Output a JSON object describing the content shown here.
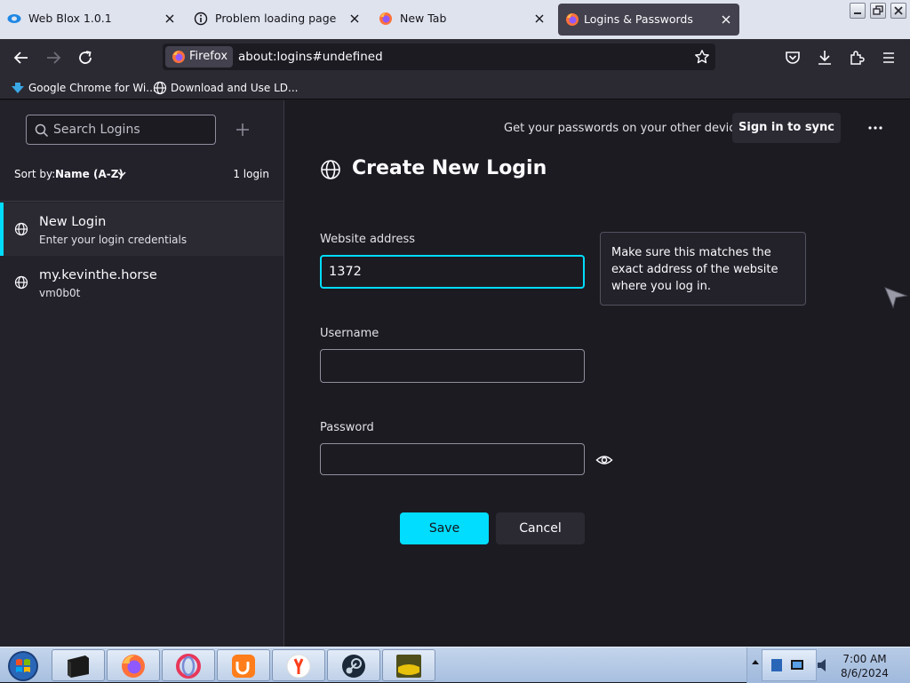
{
  "window": {
    "tabs": [
      {
        "label": "Web Blox 1.0.1",
        "icon": "web-blox-icon",
        "active": false
      },
      {
        "label": "Problem loading page",
        "icon": "info-icon",
        "active": false
      },
      {
        "label": "New Tab",
        "icon": "firefox-icon",
        "active": false
      },
      {
        "label": "Logins & Passwords",
        "icon": "firefox-icon",
        "active": true
      }
    ]
  },
  "navbar": {
    "identity_label": "Firefox",
    "url": "about:logins#undefined"
  },
  "bookmarks": [
    {
      "label": "Google Chrome for Wi...",
      "icon": "chrome-download-icon"
    },
    {
      "label": "Download and Use LD...",
      "icon": "globe-icon"
    }
  ],
  "sidebar": {
    "search_placeholder": "Search Logins",
    "sort_label": "Sort by:",
    "sort_value": "Name (A-Z)",
    "login_count": "1 login",
    "items": [
      {
        "title": "New Login",
        "subtitle": "Enter your login credentials",
        "selected": true
      },
      {
        "title": "my.kevinthe.horse",
        "subtitle": "vm0b0t",
        "selected": false
      }
    ]
  },
  "main": {
    "sync_message": "Get your passwords on your other devices",
    "sync_button": "Sign in to sync",
    "title": "Create New Login",
    "website_label": "Website address",
    "website_value": "1372",
    "tooltip": "Make sure this matches the exact address of the website where you log in.",
    "username_label": "Username",
    "username_value": "",
    "password_label": "Password",
    "password_value": "",
    "save_button": "Save",
    "cancel_button": "Cancel"
  },
  "taskbar": {
    "apps": [
      "window-app-icon",
      "firefox-icon",
      "opera-icon",
      "uc-browser-icon",
      "yandex-icon",
      "steam-icon",
      "app-icon"
    ],
    "time": "7:00 AM",
    "date": "8/6/2024"
  },
  "colors": {
    "accent": "#00ddff",
    "background": "#1c1b22",
    "sidebar": "#23222b"
  }
}
